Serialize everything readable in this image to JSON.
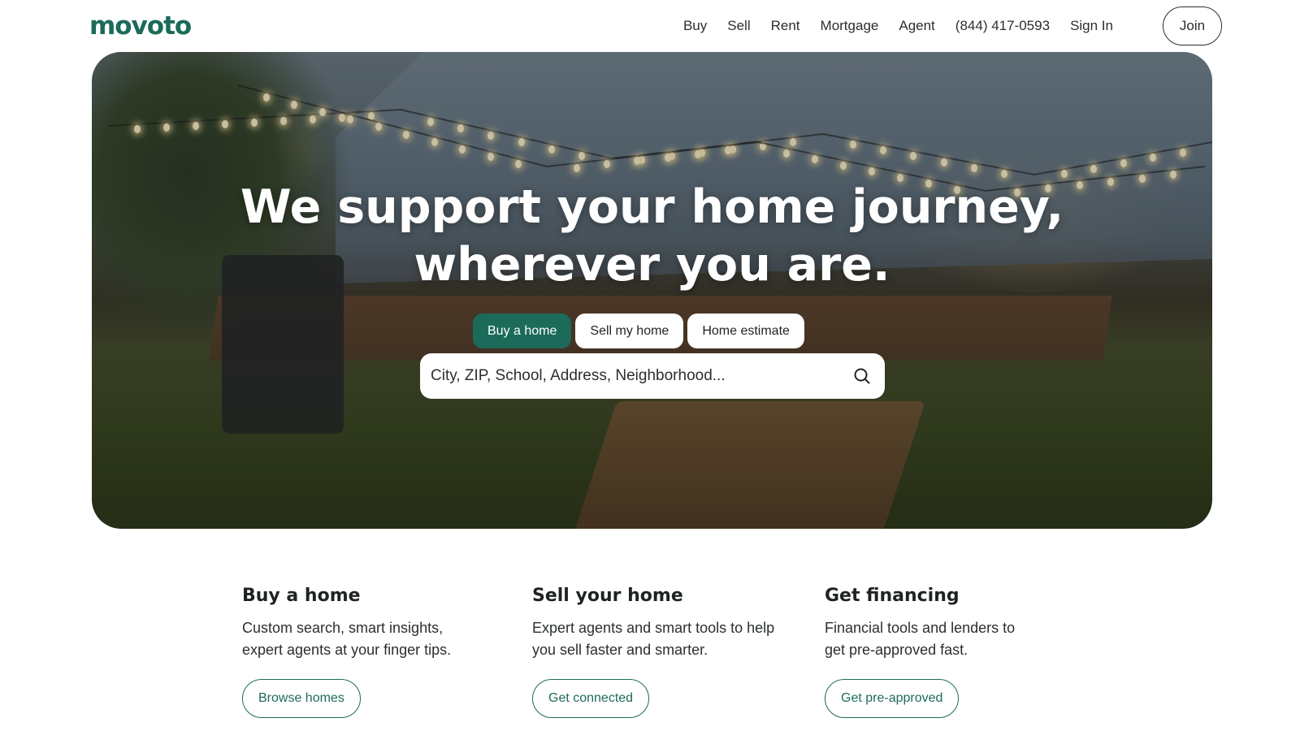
{
  "brand": {
    "logo_text": "movoto",
    "accent_color": "#1c6b5a"
  },
  "nav": {
    "items": [
      "Buy",
      "Sell",
      "Rent",
      "Mortgage",
      "Agent"
    ],
    "phone": "(844) 417-0593",
    "sign_in": "Sign In",
    "join": "Join"
  },
  "hero": {
    "title_line1": "We support your home journey,",
    "title_line2": "wherever you are.",
    "tabs": [
      {
        "label": "Buy a home",
        "active": true
      },
      {
        "label": "Sell my home",
        "active": false
      },
      {
        "label": "Home estimate",
        "active": false
      }
    ],
    "search": {
      "placeholder": "City, ZIP, School, Address, Neighborhood...",
      "value": "",
      "icon": "search-icon"
    }
  },
  "features": [
    {
      "title": "Buy a home",
      "desc_line1": "Custom search, smart insights,",
      "desc_line2": "expert agents at your finger tips.",
      "cta": "Browse homes"
    },
    {
      "title": "Sell your home",
      "desc_line1": "Expert agents and smart tools to help",
      "desc_line2": "you sell faster and smarter.",
      "cta": "Get connected"
    },
    {
      "title": "Get financing",
      "desc_line1": "Financial tools and lenders to",
      "desc_line2": "get pre-approved fast.",
      "cta": "Get pre-approved"
    }
  ]
}
